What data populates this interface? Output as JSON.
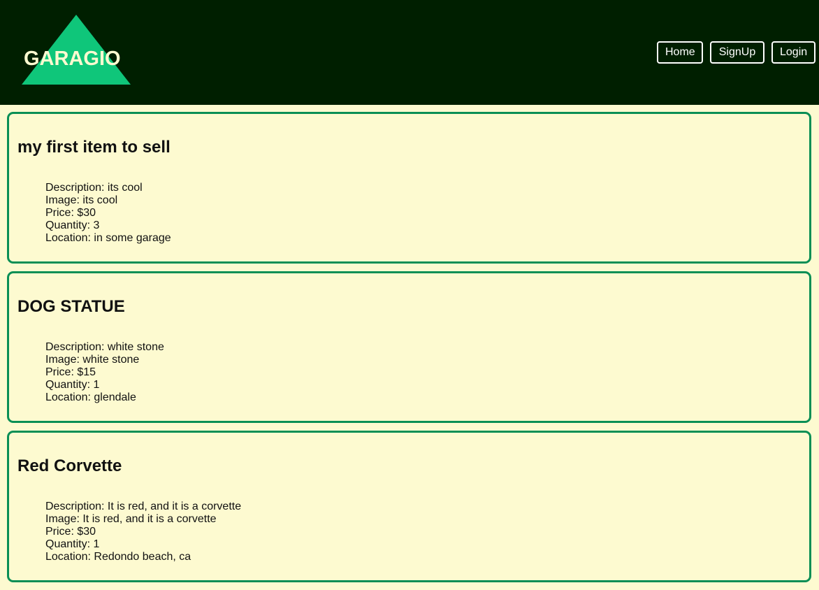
{
  "header": {
    "brand": "GARAGIO",
    "nav": {
      "home": "Home",
      "signup": "SignUp",
      "login": "Login"
    },
    "colors": {
      "background": "#001f00",
      "logo_triangle": "#0fc67a",
      "logo_text": "#fdfad0"
    }
  },
  "listings": [
    {
      "title": "my first item to sell",
      "description": "Description: its cool",
      "image": "Image: its cool",
      "price": "Price: $30",
      "quantity": "Quantity: 3",
      "location": "Location: in some garage"
    },
    {
      "title": "DOG STATUE",
      "description": "Description: white stone",
      "image": "Image: white stone",
      "price": "Price: $15",
      "quantity": "Quantity: 1",
      "location": "Location: glendale"
    },
    {
      "title": "Red Corvette",
      "description": "Description: It is red, and it is a corvette",
      "image": "Image: It is red, and it is a corvette",
      "price": "Price: $30",
      "quantity": "Quantity: 1",
      "location": "Location: Redondo beach, ca"
    }
  ],
  "theme": {
    "page_background": "#fdfad0",
    "card_border": "#0a8f55"
  }
}
